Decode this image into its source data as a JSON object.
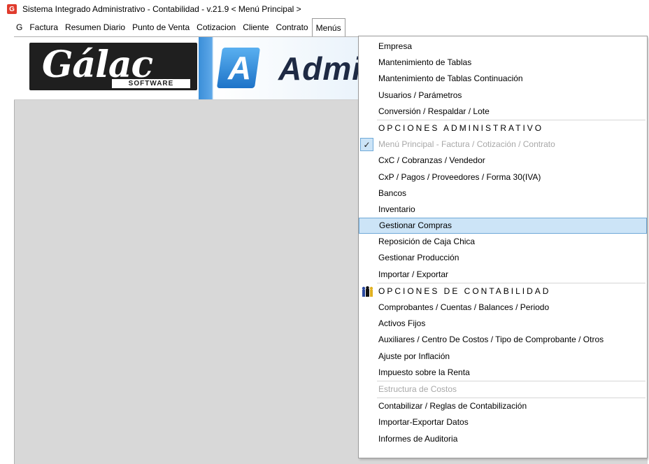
{
  "window": {
    "title": "Sistema Integrado Administrativo - Contabilidad - v.21.9 < Menú Principal >",
    "icon_letter": "G"
  },
  "menubar": {
    "items": [
      {
        "label": "G"
      },
      {
        "label": "Factura"
      },
      {
        "label": "Resumen Diario"
      },
      {
        "label": "Punto de Venta"
      },
      {
        "label": "Cotizacion"
      },
      {
        "label": "Cliente"
      },
      {
        "label": "Contrato"
      },
      {
        "label": "Menús",
        "active": true
      }
    ]
  },
  "banner": {
    "logo_text": "Gálac",
    "logo_subtitle": "SOFTWARE",
    "badge_letter": "A",
    "product_text": "Admi"
  },
  "dropdown": {
    "items": [
      {
        "label": "Empresa"
      },
      {
        "label": "Mantenimiento de Tablas"
      },
      {
        "label": "Mantenimiento de Tablas Continuación"
      },
      {
        "label": "Usuarios / Parámetros"
      },
      {
        "label": "Conversión / Respaldar / Lote"
      },
      {
        "label": "OPCIONES ADMINISTRATIVO"
      },
      {
        "label": "Menú Principal - Factura / Cotización / Contrato"
      },
      {
        "label": "CxC / Cobranzas / Vendedor"
      },
      {
        "label": "CxP / Pagos / Proveedores / Forma 30(IVA)"
      },
      {
        "label": "Bancos"
      },
      {
        "label": "Inventario"
      },
      {
        "label": "Gestionar Compras"
      },
      {
        "label": "Reposición de Caja Chica"
      },
      {
        "label": "Gestionar Producción"
      },
      {
        "label": "Importar / Exportar"
      },
      {
        "label": "OPCIONES DE CONTABILIDAD"
      },
      {
        "label": "Comprobantes / Cuentas / Balances / Periodo"
      },
      {
        "label": "Activos Fijos"
      },
      {
        "label": "Auxiliares / Centro De Costos / Tipo de Comprobante / Otros"
      },
      {
        "label": "Ajuste por Inflación"
      },
      {
        "label": "Impuesto sobre la Renta"
      },
      {
        "label": "Estructura de Costos"
      },
      {
        "label": "Contabilizar / Reglas de Contabilización"
      },
      {
        "label": "Importar-Exportar Datos"
      },
      {
        "label": "Informes de Auditoria"
      }
    ],
    "check_mark": "✓"
  }
}
